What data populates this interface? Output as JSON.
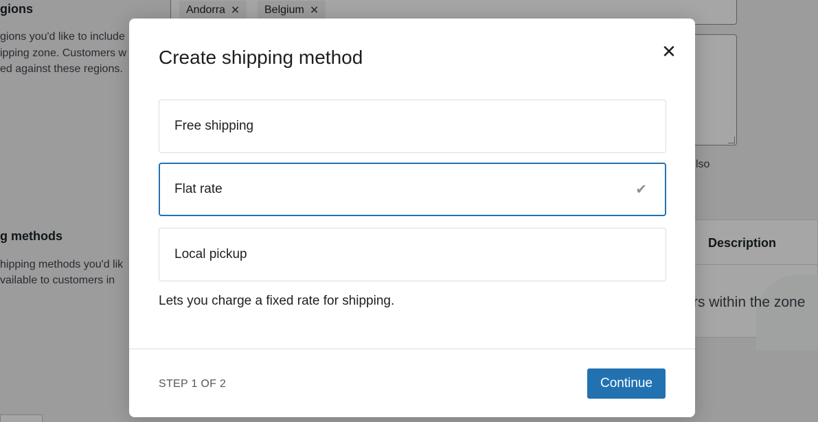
{
  "background": {
    "regions_heading": "gions",
    "regions_desc": [
      "gions you'd like to include",
      "ipping zone. Customers w",
      "ed against these regions."
    ],
    "regions_tags": [
      {
        "label": "Andorra"
      },
      {
        "label": "Belgium"
      }
    ],
    "partial_text_right": "lso",
    "methods_heading": "g methods",
    "methods_desc": [
      "hipping methods you'd lik",
      "vailable to customers in"
    ],
    "table_header_description": "Description",
    "table_empty_partial": "rs within the zone"
  },
  "modal": {
    "title": "Create shipping method",
    "options": [
      {
        "label": "Free shipping",
        "selected": false
      },
      {
        "label": "Flat rate",
        "selected": true
      },
      {
        "label": "Local pickup",
        "selected": false
      }
    ],
    "selected_check": "✔",
    "description": "Lets you charge a fixed rate for shipping.",
    "step": "STEP 1 OF 2",
    "continue_label": "Continue",
    "close_glyph": "✕"
  },
  "colors": {
    "primary": "#2271b1",
    "overlay": "rgba(0,0,0,0.35)"
  }
}
